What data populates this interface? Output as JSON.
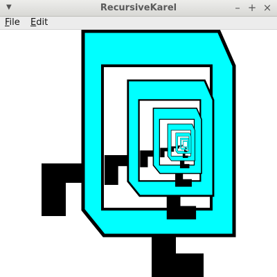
{
  "window": {
    "title": "RecursiveKarel",
    "menu_icon": "dropdown-arrow-icon",
    "minimize_symbol": "–",
    "maximize_symbol": "+",
    "close_symbol": "×"
  },
  "menubar": {
    "items": [
      {
        "label": "File",
        "mnemonic": "F",
        "rest": "ile"
      },
      {
        "label": "Edit",
        "mnemonic": "E",
        "rest": "dit"
      }
    ]
  },
  "canvas": {
    "content": "recursive-karel-drawing",
    "colors": {
      "body": "#00ffff",
      "outline": "#000000",
      "background": "#ffffff"
    }
  }
}
